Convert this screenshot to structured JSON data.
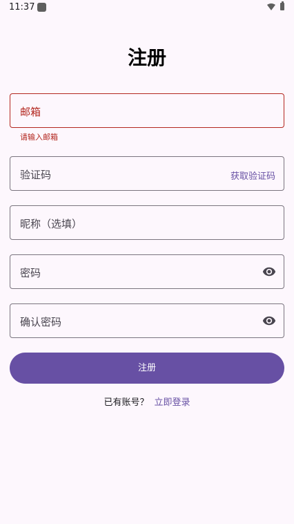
{
  "status_bar": {
    "time": "11:37"
  },
  "page": {
    "title": "注册"
  },
  "form": {
    "email": {
      "label": "邮箱",
      "error": "请输入邮箱"
    },
    "code": {
      "label": "验证码",
      "action": "获取验证码"
    },
    "nickname": {
      "label": "昵称（选填）"
    },
    "password": {
      "label": "密码",
      "icon": "eye-icon"
    },
    "confirm_password": {
      "label": "确认密码",
      "icon": "eye-icon"
    },
    "submit": "注册"
  },
  "footer": {
    "prompt": "已有账号？",
    "login_link": "立即登录"
  },
  "colors": {
    "primary": "#6750a4",
    "error": "#b3261e",
    "background": "#fdf7fd"
  }
}
